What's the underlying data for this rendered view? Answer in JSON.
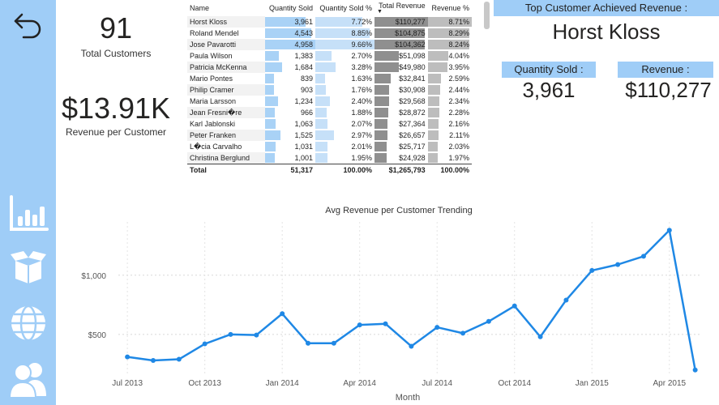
{
  "sidebar": {
    "items": [
      {
        "name": "back-icon"
      },
      {
        "name": "bar-chart-icon"
      },
      {
        "name": "box-icon"
      },
      {
        "name": "globe-icon"
      },
      {
        "name": "users-icon"
      }
    ]
  },
  "kpis": {
    "customers_value": "91",
    "customers_label": "Total Customers",
    "revenue_value": "$13.91K",
    "revenue_label": "Revenue per Customer"
  },
  "table": {
    "headers": [
      "Name",
      "Quantity Sold",
      "Quantity Sold %",
      "Total Revenue",
      "Revenue %"
    ],
    "rows": [
      {
        "name": "Horst Kloss",
        "qty": "3,961",
        "qty_pct": "7.72%",
        "rev": "$110,277",
        "rev_pct": "8.71%",
        "qty_frac": 0.8,
        "qtyp_frac": 0.8,
        "rev_frac": 1.0,
        "revp_frac": 1.0
      },
      {
        "name": "Roland Mendel",
        "qty": "4,543",
        "qty_pct": "8.85%",
        "rev": "$104,875",
        "rev_pct": "8.29%",
        "qty_frac": 0.92,
        "qtyp_frac": 0.92,
        "rev_frac": 0.95,
        "revp_frac": 0.95
      },
      {
        "name": "Jose Pavarotti",
        "qty": "4,958",
        "qty_pct": "9.66%",
        "rev": "$104,362",
        "rev_pct": "8.24%",
        "qty_frac": 1.0,
        "qtyp_frac": 1.0,
        "rev_frac": 0.95,
        "revp_frac": 0.95
      },
      {
        "name": "Paula Wilson",
        "qty": "1,383",
        "qty_pct": "2.70%",
        "rev": "$51,098",
        "rev_pct": "4.04%",
        "qty_frac": 0.28,
        "qtyp_frac": 0.28,
        "rev_frac": 0.46,
        "revp_frac": 0.46
      },
      {
        "name": "Patricia McKenna",
        "qty": "1,684",
        "qty_pct": "3.28%",
        "rev": "$49,980",
        "rev_pct": "3.95%",
        "qty_frac": 0.34,
        "qtyp_frac": 0.34,
        "rev_frac": 0.45,
        "revp_frac": 0.45
      },
      {
        "name": "Mario Pontes",
        "qty": "839",
        "qty_pct": "1.63%",
        "rev": "$32,841",
        "rev_pct": "2.59%",
        "qty_frac": 0.17,
        "qtyp_frac": 0.17,
        "rev_frac": 0.3,
        "revp_frac": 0.3
      },
      {
        "name": "Philip Cramer",
        "qty": "903",
        "qty_pct": "1.76%",
        "rev": "$30,908",
        "rev_pct": "2.44%",
        "qty_frac": 0.18,
        "qtyp_frac": 0.18,
        "rev_frac": 0.28,
        "revp_frac": 0.28
      },
      {
        "name": "Maria Larsson",
        "qty": "1,234",
        "qty_pct": "2.40%",
        "rev": "$29,568",
        "rev_pct": "2.34%",
        "qty_frac": 0.25,
        "qtyp_frac": 0.25,
        "rev_frac": 0.27,
        "revp_frac": 0.27
      },
      {
        "name": "Jean Fresni�re",
        "qty": "966",
        "qty_pct": "1.88%",
        "rev": "$28,872",
        "rev_pct": "2.28%",
        "qty_frac": 0.19,
        "qtyp_frac": 0.19,
        "rev_frac": 0.26,
        "revp_frac": 0.26
      },
      {
        "name": "Karl Jablonski",
        "qty": "1,063",
        "qty_pct": "2.07%",
        "rev": "$27,364",
        "rev_pct": "2.16%",
        "qty_frac": 0.21,
        "qtyp_frac": 0.21,
        "rev_frac": 0.25,
        "revp_frac": 0.25
      },
      {
        "name": "Peter Franken",
        "qty": "1,525",
        "qty_pct": "2.97%",
        "rev": "$26,657",
        "rev_pct": "2.11%",
        "qty_frac": 0.31,
        "qtyp_frac": 0.31,
        "rev_frac": 0.24,
        "revp_frac": 0.24
      },
      {
        "name": "L�cia Carvalho",
        "qty": "1,031",
        "qty_pct": "2.01%",
        "rev": "$25,717",
        "rev_pct": "2.03%",
        "qty_frac": 0.21,
        "qtyp_frac": 0.21,
        "rev_frac": 0.23,
        "revp_frac": 0.23
      },
      {
        "name": "Christina Berglund",
        "qty": "1,001",
        "qty_pct": "1.95%",
        "rev": "$24,928",
        "rev_pct": "1.97%",
        "qty_frac": 0.2,
        "qtyp_frac": 0.2,
        "rev_frac": 0.23,
        "revp_frac": 0.23
      }
    ],
    "total": {
      "name": "Total",
      "qty": "51,317",
      "qty_pct": "100.00%",
      "rev": "$1,265,793",
      "rev_pct": "100.00%"
    }
  },
  "top_customer": {
    "banner": "Top Customer Achieved Revenue :",
    "name": "Horst Kloss",
    "qty_label": "Quantity Sold :",
    "qty_value": "3,961",
    "rev_label": "Revenue :",
    "rev_value": "$110,277"
  },
  "colors": {
    "sidebar": "#9fcdf7",
    "qty_bar": "#a9d2f6",
    "rev_bar": "#8f8f8f",
    "line": "#1f88e5"
  },
  "chart_data": {
    "type": "line",
    "title": "Avg Revenue per Customer Trending",
    "xlabel": "Month",
    "ylabel": "",
    "x": [
      "2013-07",
      "2013-08",
      "2013-09",
      "2013-10",
      "2013-11",
      "2013-12",
      "2014-01",
      "2014-02",
      "2014-03",
      "2014-04",
      "2014-05",
      "2014-06",
      "2014-07",
      "2014-08",
      "2014-09",
      "2014-10",
      "2014-11",
      "2014-12",
      "2015-01",
      "2015-02",
      "2015-03",
      "2015-04",
      "2015-05"
    ],
    "values": [
      310,
      280,
      290,
      420,
      500,
      495,
      675,
      425,
      425,
      580,
      590,
      400,
      560,
      510,
      610,
      740,
      480,
      790,
      1040,
      1090,
      1160,
      1380,
      200
    ],
    "x_ticks": [
      "Jul 2013",
      "Oct 2013",
      "Jan 2014",
      "Apr 2014",
      "Jul 2014",
      "Oct 2014",
      "Jan 2015",
      "Apr 2015"
    ],
    "y_ticks": [
      "$500",
      "$1,000"
    ],
    "ylim": [
      150,
      1450
    ],
    "grid": true
  }
}
